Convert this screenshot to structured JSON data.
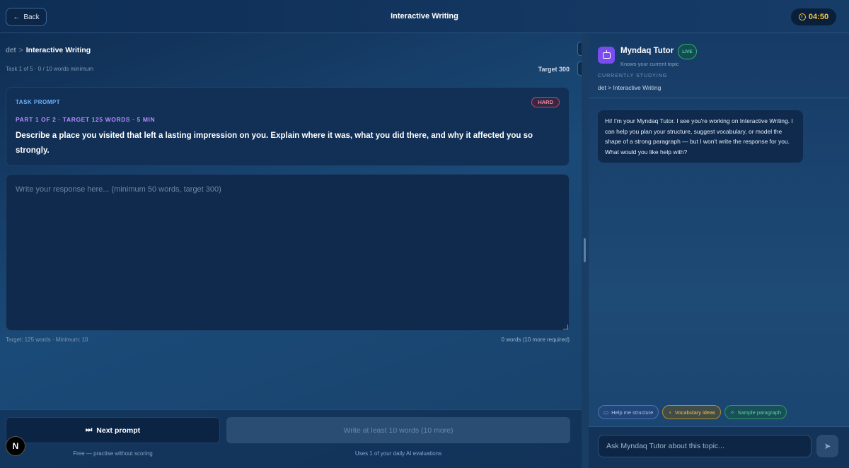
{
  "topbar": {
    "back_label": "Back",
    "back_icon": "arrow-left-icon",
    "title": "Interactive Writing",
    "timer": "04:50",
    "timer_icon": "clock-icon"
  },
  "breadcrumb": {
    "root": "det",
    "separator": ">",
    "current": "Interactive Writing"
  },
  "task_meta": "Task 1 of 5 · 0 / 10 words minimum",
  "target_label": "Target 300",
  "prompt": {
    "label": "TASK PROMPT",
    "difficulty": "HARD",
    "part": "PART 1 OF 2 · TARGET 125 WORDS · 5 MIN",
    "text": "Describe a place you visited that left a lasting impression on you. Explain where it was, what you did there, and why it affected you so strongly."
  },
  "response": {
    "value": "",
    "placeholder": "Write your response here... (minimum 50 words, target 300)"
  },
  "hints": {
    "left": "Target: 125 words · Minimum: 10",
    "right": "0 words (10 more required)"
  },
  "footer": {
    "next_label": "Next prompt",
    "next_icon": "skip-forward-icon",
    "write_label": "Write at least 10 words (10 more)",
    "note_left": "Free — practise without scoring",
    "note_right": "Uses 1 of your daily AI evaluations"
  },
  "badge": "N",
  "tutor": {
    "name": "Myndaq Tutor",
    "status": "LIVE",
    "subtitle": "Knows your current topic",
    "studying_label": "CURRENTLY STUDYING",
    "studying_value": "det > Interactive Writing",
    "message": "Hi! I'm your Myndaq Tutor. I see you're working on Interactive Writing. I can help you plan your structure, suggest vocabulary, or model the shape of a strong paragraph — but I won't write the response for you. What would you like help with?",
    "chips": [
      "Help me structure",
      "Vocabulary ideas",
      "Sample paragraph"
    ],
    "input_placeholder": "Ask Myndaq Tutor about this topic...",
    "send_icon": "send-icon"
  },
  "colors": {
    "accent_blue": "#6fb3ff",
    "accent_purple": "#b58cff",
    "timer_yellow": "#f4c542",
    "hard_red": "#f08a97",
    "live_green": "#4ad68a"
  }
}
